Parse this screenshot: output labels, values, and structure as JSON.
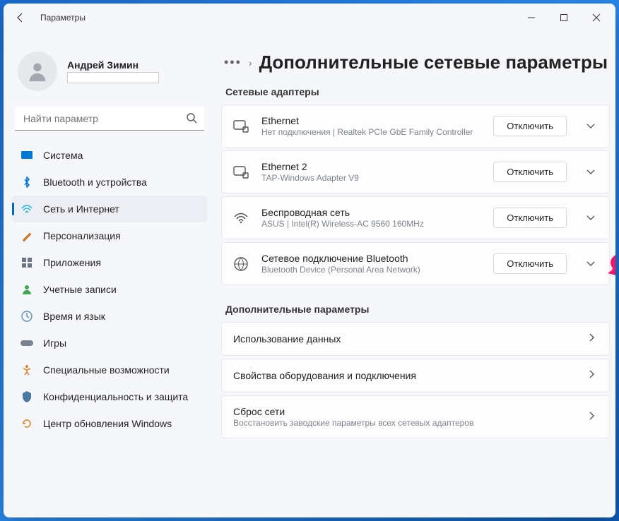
{
  "window": {
    "title": "Параметры"
  },
  "user": {
    "name": "Андрей Зимин"
  },
  "search": {
    "placeholder": "Найти параметр"
  },
  "sidebar": {
    "items": [
      {
        "label": "Система",
        "icon": "system-icon"
      },
      {
        "label": "Bluetooth и устройства",
        "icon": "bluetooth-icon"
      },
      {
        "label": "Сеть и Интернет",
        "icon": "network-icon",
        "active": true
      },
      {
        "label": "Персонализация",
        "icon": "personalization-icon"
      },
      {
        "label": "Приложения",
        "icon": "apps-icon"
      },
      {
        "label": "Учетные записи",
        "icon": "accounts-icon"
      },
      {
        "label": "Время и язык",
        "icon": "time-language-icon"
      },
      {
        "label": "Игры",
        "icon": "gaming-icon"
      },
      {
        "label": "Специальные возможности",
        "icon": "accessibility-icon"
      },
      {
        "label": "Конфиденциальность и защита",
        "icon": "privacy-icon"
      },
      {
        "label": "Центр обновления Windows",
        "icon": "update-icon"
      }
    ]
  },
  "breadcrumb": {
    "title": "Дополнительные сетевые параметры"
  },
  "sections": {
    "adapters": {
      "label": "Сетевые адаптеры",
      "items": [
        {
          "title": "Ethernet",
          "sub": "Нет подключения | Realtek PCIe GbE Family Controller",
          "action": "Отключить"
        },
        {
          "title": "Ethernet 2",
          "sub": "TAP-Windows Adapter V9",
          "action": "Отключить"
        },
        {
          "title": "Беспроводная сеть",
          "sub": "ASUS | Intel(R) Wireless-AC 9560 160MHz",
          "action": "Отключить"
        },
        {
          "title": "Сетевое подключение Bluetooth",
          "sub": "Bluetooth Device (Personal Area Network)",
          "action": "Отключить"
        }
      ]
    },
    "more": {
      "label": "Дополнительные параметры",
      "items": [
        {
          "title": "Использование данных"
        },
        {
          "title": "Свойства оборудования и подключения"
        },
        {
          "title": "Сброс сети",
          "sub": "Восстановить заводские параметры всех сетевых адаптеров"
        }
      ]
    }
  }
}
